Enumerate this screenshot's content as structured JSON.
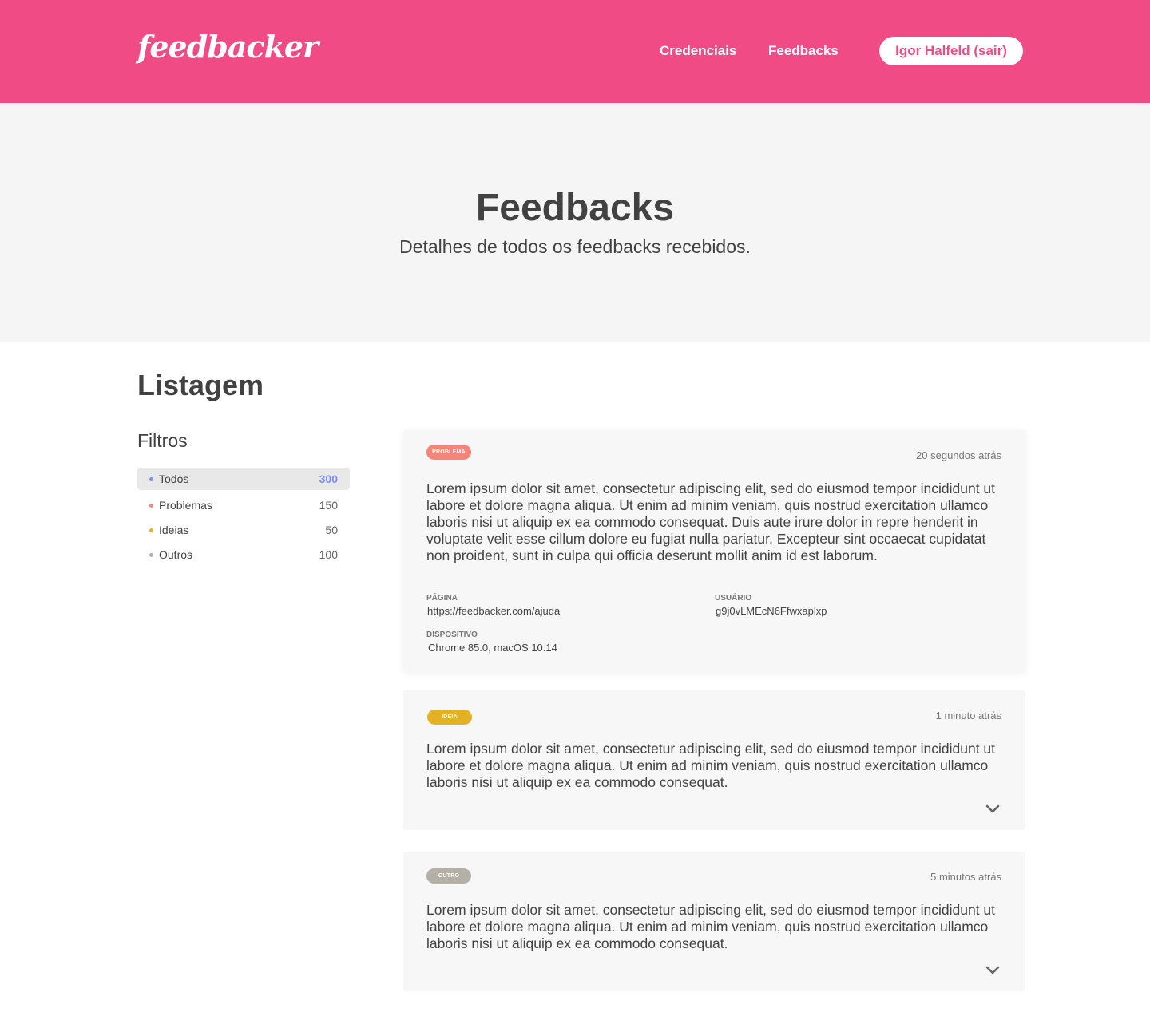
{
  "header": {
    "logo": "feedbacker",
    "nav": {
      "credentials": "Credenciais",
      "feedbacks": "Feedbacks"
    },
    "user_button": "Igor Halfeld (sair)",
    "brand_color": "#f04b84"
  },
  "hero": {
    "title": "Feedbacks",
    "subtitle": "Detalhes de todos os feedbacks recebidos."
  },
  "listing": {
    "title": "Listagem"
  },
  "filters": {
    "title": "Filtros",
    "items": [
      {
        "label": "Todos",
        "count": "300",
        "color": "#7c8cf8",
        "active": true
      },
      {
        "label": "Problemas",
        "count": "150",
        "color": "#f3857b",
        "active": false
      },
      {
        "label": "Ideias",
        "count": "50",
        "color": "#e2b124",
        "active": false
      },
      {
        "label": "Outros",
        "count": "100",
        "color": "#b5b0a6",
        "active": false
      }
    ]
  },
  "feedbacks": [
    {
      "type": "PROBLEMA",
      "type_color": "#f3857b",
      "time": "20 segundos atrás",
      "text": "Lorem ipsum dolor sit amet, consectetur adipiscing elit, sed do eiusmod tempor incididunt ut labore et dolore magna aliqua. Ut enim ad minim veniam, quis nostrud exercitation ullamco laboris nisi ut aliquip ex ea commodo consequat. Duis aute irure dolor in repre henderit in voluptate velit esse cillum dolore eu fugiat nulla pariatur. Excepteur sint occaecat cupidatat non proident, sunt in culpa qui officia deserunt mollit anim id est laborum.",
      "page_label": "PÁGINA",
      "page": "https://feedbacker.com/ajuda",
      "user_label": "USUÁRIO",
      "user": "g9j0vLMEcN6Ffwxaplxp",
      "device_label": "DISPOSITIVO",
      "device": "Chrome 85.0, macOS 10.14"
    },
    {
      "type": "IDEIA",
      "type_color": "#e2b124",
      "time": "1 minuto atrás",
      "text": "Lorem ipsum dolor sit amet, consectetur adipiscing elit, sed do eiusmod tempor incididunt ut labore et dolore magna aliqua. Ut enim ad minim veniam, quis nostrud exercitation ullamco laboris nisi ut aliquip ex ea commodo consequat."
    },
    {
      "type": "OUTRO",
      "type_color": "#b5b0a6",
      "time": "5 minutos atrás",
      "text": "Lorem ipsum dolor sit amet, consectetur adipiscing elit, sed do eiusmod tempor incididunt ut labore et dolore magna aliqua. Ut enim ad minim veniam, quis nostrud exercitation ullamco laboris nisi ut aliquip ex ea commodo consequat."
    }
  ],
  "icons": {
    "expand": "chevron-down-icon"
  }
}
